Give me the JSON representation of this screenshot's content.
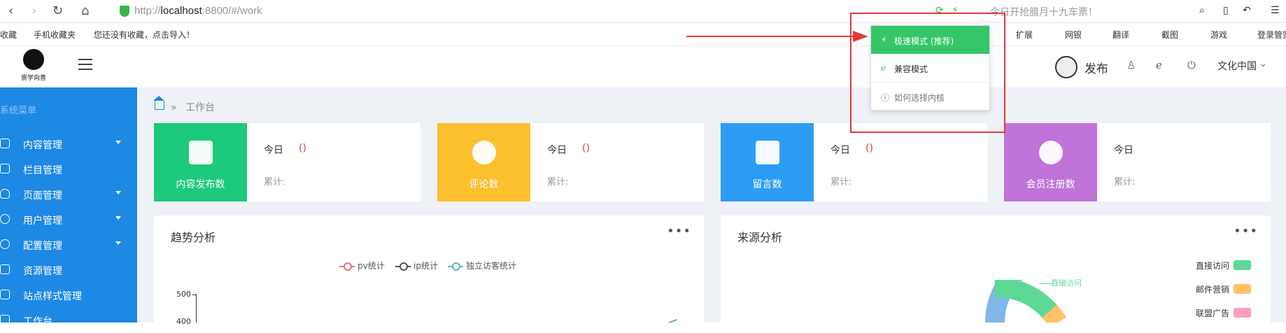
{
  "browser": {
    "url_prefix": "http://",
    "url_host": "localhost",
    "url_rest": ":8800/#/work",
    "promo": "今日开抢腊月十九车票！"
  },
  "favbar": {
    "items": [
      "收藏",
      "手机收藏夹",
      "您还没有收藏，点击导入！"
    ],
    "right_items": [
      "扩展",
      "网银",
      "翻译",
      "截图",
      "游戏",
      "登录管家"
    ]
  },
  "header": {
    "logo_text": "崇学向善",
    "publish_label": "发布",
    "region_label": "文化中国"
  },
  "sidebar": {
    "title": "系统菜单",
    "items": [
      {
        "label": "内容管理",
        "arrow": true
      },
      {
        "label": "栏目管理",
        "arrow": false
      },
      {
        "label": "页面管理",
        "arrow": true
      },
      {
        "label": "用户管理",
        "arrow": true
      },
      {
        "label": "配置管理",
        "arrow": true
      },
      {
        "label": "资源管理",
        "arrow": false
      },
      {
        "label": "站点样式管理",
        "arrow": false
      },
      {
        "label": "工作台",
        "arrow": false
      }
    ]
  },
  "breadcrumb": {
    "sep": "»",
    "current": "工作台"
  },
  "cards": [
    {
      "label": "内容发布数",
      "today": "今日",
      "paren": "()",
      "total": "累计:",
      "color": "#1dc97c"
    },
    {
      "label": "评论数",
      "today": "今日",
      "paren": "()",
      "total": "累计:",
      "color": "#fbc02d"
    },
    {
      "label": "留言数",
      "today": "今日",
      "paren": "()",
      "total": "累计:",
      "color": "#2d9cf5"
    },
    {
      "label": "会员注册数",
      "today": "今日",
      "paren": "",
      "total": "累计:",
      "color": "#c073d9"
    }
  ],
  "panels": {
    "trend_title": "趋势分析",
    "source_title": "来源分析",
    "more": "•••"
  },
  "trend_legend": [
    {
      "label": "pv统计",
      "color": "#e57373"
    },
    {
      "label": "ip统计",
      "color": "#555555"
    },
    {
      "label": "独立访客统计",
      "color": "#5fb3b3"
    }
  ],
  "trend_axis": {
    "tick1": "500",
    "tick2": "400"
  },
  "source_legend": [
    {
      "label": "直接访问",
      "color": "#5fd896"
    },
    {
      "label": "邮件营销",
      "color": "#ffc266"
    },
    {
      "label": "联盟广告",
      "color": "#ff9ec3"
    }
  ],
  "source_callout": "直接访问",
  "popup": {
    "options": [
      "极速模式 (推荐)",
      "兼容模式",
      "如何选择内核"
    ],
    "selected_color": "#35c668"
  }
}
